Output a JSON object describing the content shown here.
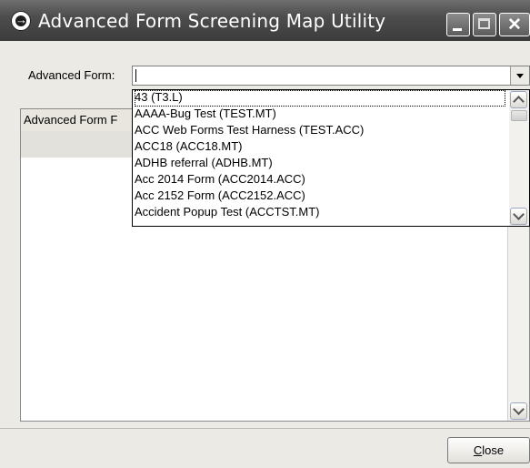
{
  "window": {
    "title": "Advanced Form Screening Map Utility",
    "icons": [
      "app-icon",
      "minimize-icon",
      "maximize-icon",
      "close-icon"
    ]
  },
  "form": {
    "label": "Advanced Form:",
    "value": "",
    "options": [
      "43 (T3.L)",
      "AAAA-Bug Test (TEST.MT)",
      "ACC Web Forms Test Harness (TEST.ACC)",
      "ACC18 (ACC18.MT)",
      "ADHB referral (ADHB.MT)",
      "Acc 2014 Form (ACC2014.ACC)",
      "Acc 2152 Form (ACC2152.ACC)",
      "Accident Popup Test (ACCTST.MT)"
    ]
  },
  "grid": {
    "header": "Advanced Form F"
  },
  "buttons": {
    "close_label": "Close"
  }
}
